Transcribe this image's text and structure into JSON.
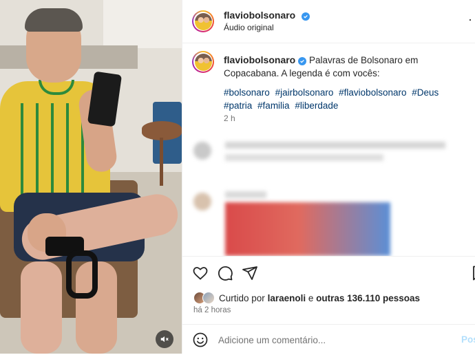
{
  "post": {
    "username": "flaviobolsonaro",
    "audio_label": "Áudio original",
    "more_label": "·",
    "caption": "Palavras de Bolsonaro em Copacabana. A legenda é com vocês:",
    "hashtags": [
      "#bolsonaro",
      "#jairbolsonaro",
      "#flaviobolsonaro",
      "#Deus",
      "#patria",
      "#familia",
      "#liberdade"
    ],
    "caption_time": "2 h"
  },
  "likes": {
    "prefix": "Curtido por",
    "user": "laraenoli",
    "connector": "e",
    "others": "outras 136.110 pessoas"
  },
  "post_time": "há 2 horas",
  "comment": {
    "placeholder": "Adicione um comentário...",
    "post_label": "Pos"
  },
  "colors": {
    "link": "#00376b",
    "verified": "#3897f0",
    "muted_text": "#737373"
  },
  "icons": [
    "heart-icon",
    "comment-icon",
    "share-icon",
    "bookmark-icon",
    "emoji-icon",
    "mute-icon",
    "verified-icon"
  ]
}
